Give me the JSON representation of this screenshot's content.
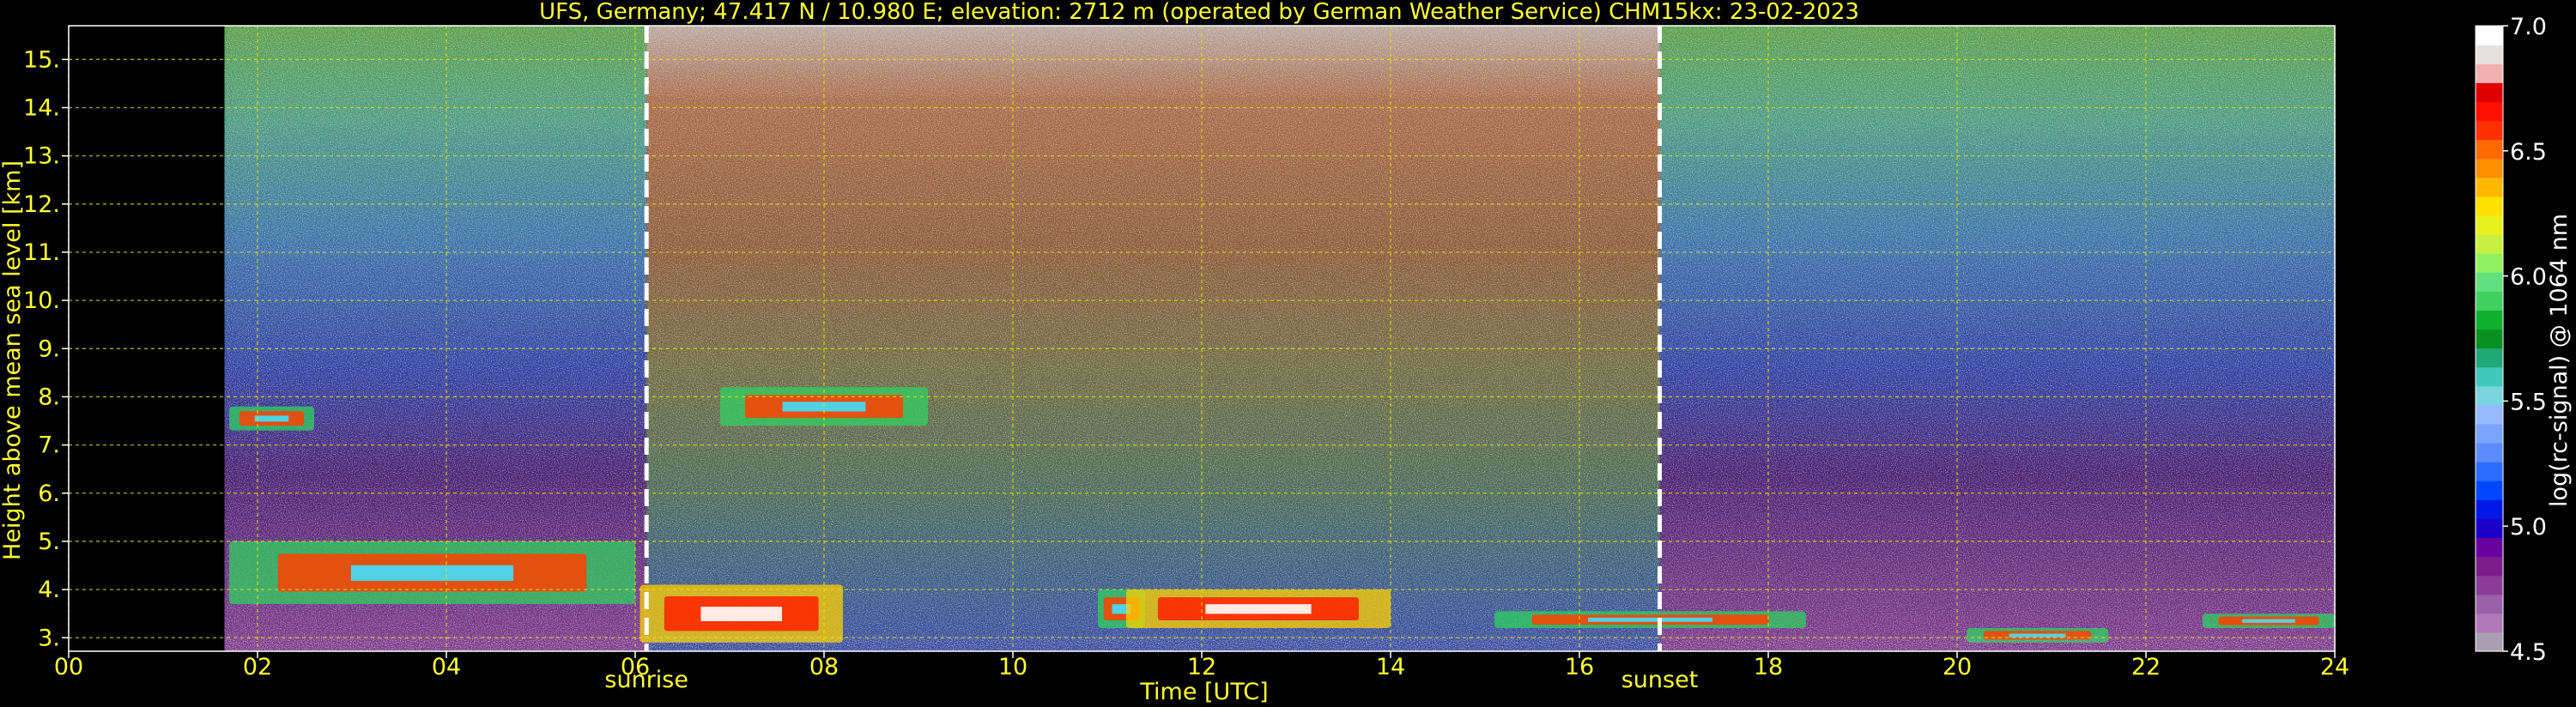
{
  "chart_data": {
    "type": "heatmap",
    "title": "UFS, Germany; 47.417 N / 10.980 E; elevation: 2712 m  (operated by German Weather Service)    CHM15kx: 23-02-2023",
    "xlabel": "Time [UTC]",
    "ylabel": "Height above mean sea level [km]",
    "xlim": [
      0,
      24
    ],
    "ylim": [
      2.72,
      15.7
    ],
    "x_ticks": [
      "00",
      "02",
      "04",
      "06",
      "08",
      "10",
      "12",
      "14",
      "16",
      "18",
      "20",
      "22",
      "24"
    ],
    "y_ticks": [
      "3.",
      "4.",
      "5.",
      "6.",
      "7.",
      "8.",
      "9.",
      "10.",
      "11.",
      "12.",
      "13.",
      "14.",
      "15."
    ],
    "grid": true,
    "data_start_hour": 1.65,
    "events": [
      {
        "label": "sunrise",
        "hour": 6.12
      },
      {
        "label": "sunset",
        "hour": 16.85
      }
    ],
    "colorbar": {
      "label": "log(rc-signal) @ 1064 nm",
      "range": [
        4.5,
        7.0
      ],
      "ticks": [
        "4.5",
        "5.0",
        "5.5",
        "6.0",
        "6.5",
        "7.0"
      ],
      "colors": [
        "#a8a0b0",
        "#b07ab8",
        "#9a60a8",
        "#8a3c98",
        "#7a1c8a",
        "#6a00a0",
        "#1a00c8",
        "#0018e8",
        "#0048ff",
        "#2c6cff",
        "#5a8cff",
        "#7aa4ff",
        "#98b8ff",
        "#7ad4e0",
        "#40c8b8",
        "#20a878",
        "#089020",
        "#10b030",
        "#40d060",
        "#60e080",
        "#90f060",
        "#c8f040",
        "#e8f020",
        "#ffe000",
        "#ffb800",
        "#ff9000",
        "#ff6800",
        "#ff3000",
        "#ff1000",
        "#e00000",
        "#f0b0b0",
        "#e8e0e0",
        "#ffffff"
      ]
    },
    "features": [
      {
        "kind": "cloud",
        "t0": 1.7,
        "t1": 6.0,
        "h0": 3.7,
        "h1": 5.0,
        "intensity": "high"
      },
      {
        "kind": "cloud",
        "t0": 6.05,
        "t1": 8.2,
        "h0": 2.9,
        "h1": 4.1,
        "intensity": "very-high"
      },
      {
        "kind": "cloud",
        "t0": 1.7,
        "t1": 2.6,
        "h0": 7.3,
        "h1": 7.8,
        "intensity": "high"
      },
      {
        "kind": "cloud",
        "t0": 6.9,
        "t1": 9.1,
        "h0": 7.4,
        "h1": 8.2,
        "intensity": "high"
      },
      {
        "kind": "cloud",
        "t0": 10.9,
        "t1": 11.4,
        "h0": 3.2,
        "h1": 4.0,
        "intensity": "high"
      },
      {
        "kind": "cloud",
        "t0": 11.2,
        "t1": 14.0,
        "h0": 3.2,
        "h1": 4.0,
        "intensity": "very-high"
      },
      {
        "kind": "boundary-layer",
        "t0": 15.1,
        "t1": 18.4,
        "h0": 3.2,
        "h1": 3.55,
        "intensity": "high"
      },
      {
        "kind": "boundary-layer",
        "t0": 20.1,
        "t1": 21.6,
        "h0": 2.9,
        "h1": 3.2,
        "intensity": "high"
      },
      {
        "kind": "boundary-layer",
        "t0": 22.6,
        "t1": 24.0,
        "h0": 3.2,
        "h1": 3.5,
        "intensity": "high"
      }
    ]
  }
}
